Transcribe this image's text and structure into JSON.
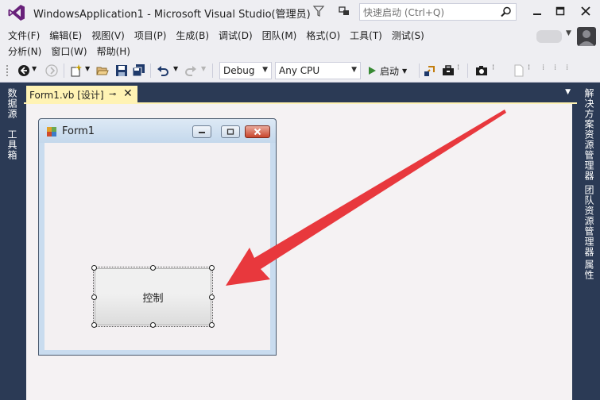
{
  "window": {
    "title": "WindowsApplication1 - Microsoft Visual Studio(管理员)",
    "quick_launch_placeholder": "快速启动 (Ctrl+Q)"
  },
  "menu": {
    "row1": [
      "文件(F)",
      "编辑(E)",
      "视图(V)",
      "项目(P)",
      "生成(B)",
      "调试(D)",
      "团队(M)",
      "格式(O)",
      "工具(T)",
      "测试(S)"
    ],
    "row2": [
      "分析(N)",
      "窗口(W)",
      "帮助(H)"
    ]
  },
  "toolbar": {
    "configuration": "Debug",
    "platform": "Any CPU",
    "start_label": "启动"
  },
  "left_rail": {
    "tabs": [
      "数据源",
      "工具箱"
    ]
  },
  "right_rail": {
    "tabs": [
      "解决方案资源管理器",
      "团队资源管理器",
      "属性"
    ]
  },
  "document_tab": {
    "label": "Form1.vb [设计]"
  },
  "form": {
    "title": "Form1",
    "button_text": "控制"
  },
  "colors": {
    "ide_frame": "#2b3a55",
    "chrome": "#eeeef2",
    "active_tab": "#fff3b4",
    "annotation_arrow": "#e8383d",
    "vs_purple": "#68217a"
  }
}
